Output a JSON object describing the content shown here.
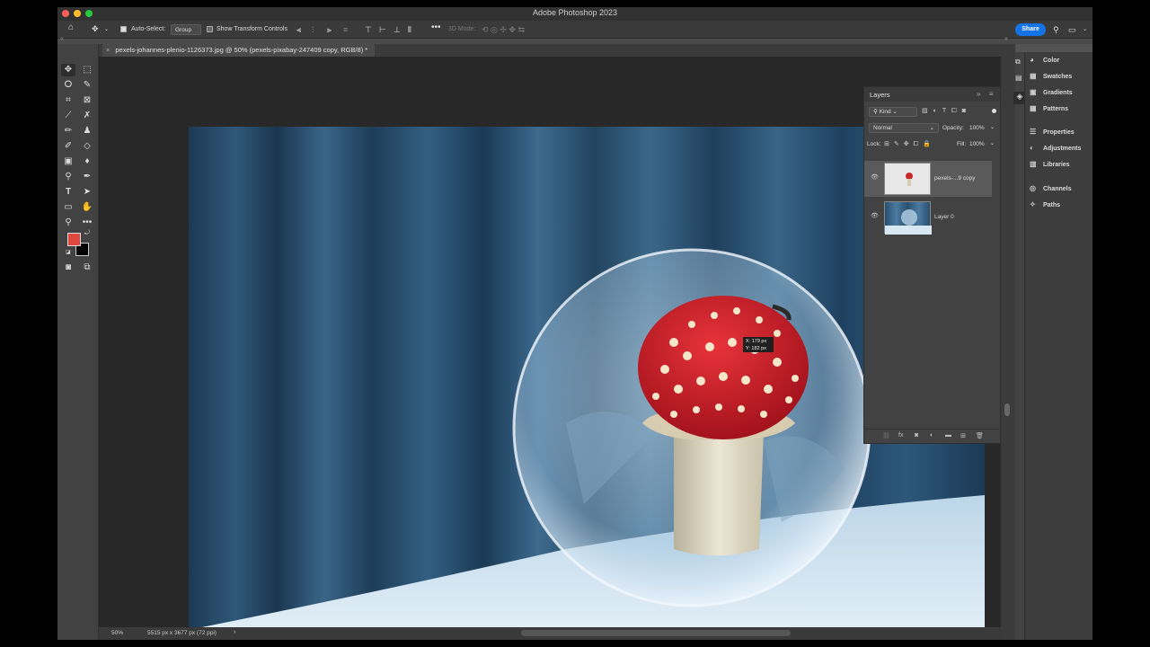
{
  "app": {
    "window_title": "Adobe Photoshop 2023",
    "traffic_colors": [
      "#ff5f57",
      "#febc2e",
      "#28c840"
    ]
  },
  "options_bar": {
    "auto_select_label": "Auto-Select:",
    "auto_select_checked": true,
    "auto_select_target": "Group",
    "transform_controls_label": "Show Transform Controls",
    "transform_controls_checked": false,
    "mode_3d_label": "3D Mode:",
    "share_label": "Share"
  },
  "document": {
    "tab_title": "pexels-johannes-plenio-1126373.jpg @ 50% (pexels-pixabay-247409 copy, RGB/8) *",
    "zoom": "50%",
    "dimensions": "5515 px x 3677 px (72 ppi)"
  },
  "colors": {
    "foreground": "#e0473f",
    "background": "#000000",
    "accent": "#1473e6"
  },
  "tooltip": {
    "x_text": "X: 179 px",
    "y_text": "Y: 182 px"
  },
  "layers_panel": {
    "title": "Layers",
    "kind_filter": "Kind",
    "blend_mode": "Normal",
    "opacity_label": "Opacity:",
    "opacity_value": "100%",
    "lock_label": "Lock:",
    "fill_label": "Fill:",
    "fill_value": "100%",
    "layers": [
      {
        "name": "pexels-...9 copy",
        "visible": true,
        "selected": true
      },
      {
        "name": "Layer 0",
        "visible": true,
        "selected": false
      }
    ]
  },
  "right_panel": {
    "items": [
      "Color",
      "Swatches",
      "Gradients",
      "Patterns",
      "Properties",
      "Adjustments",
      "Libraries",
      "Channels",
      "Paths"
    ],
    "icons": [
      "color-wheel-icon",
      "swatches-grid-icon",
      "gradient-icon",
      "patterns-grid-icon",
      "properties-icon",
      "adjustments-icon",
      "libraries-icon",
      "channels-icon",
      "paths-icon"
    ]
  }
}
